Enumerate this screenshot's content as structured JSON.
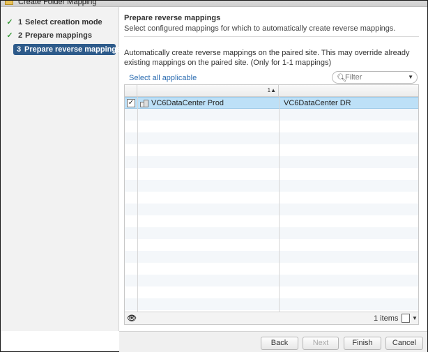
{
  "window": {
    "title": "Create Folder Mapping"
  },
  "steps": [
    {
      "num": "1",
      "label": "Select creation mode",
      "done": true
    },
    {
      "num": "2",
      "label": "Prepare mappings",
      "done": true
    },
    {
      "num": "3",
      "label": "Prepare reverse mappings",
      "active": true
    }
  ],
  "header": {
    "title": "Prepare reverse mappings",
    "subtitle": "Select configured mappings for which to automatically create reverse mappings."
  },
  "description": "Automatically create reverse mappings on the paired site. This may override already existing mappings on the paired site. (Only for 1-1 mappings)",
  "select_all_label": "Select all applicable",
  "filter": {
    "placeholder": "Filter"
  },
  "grid": {
    "sort_indicator": "1▲",
    "rows": [
      {
        "checked": true,
        "local": "VC6DataCenter Prod",
        "remote": "VC6DataCenter DR"
      }
    ],
    "item_count": "1 items"
  },
  "buttons": {
    "back": "Back",
    "next": "Next",
    "finish": "Finish",
    "cancel": "Cancel"
  },
  "colors": {
    "active_step": "#2d5a8a",
    "selected_row": "#bde0f7",
    "link": "#2a6bb0",
    "check": "#3a9a3a"
  }
}
